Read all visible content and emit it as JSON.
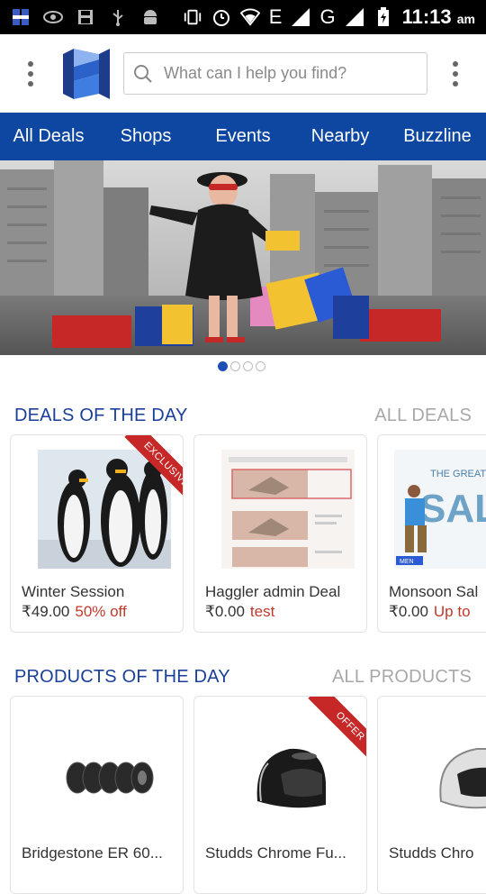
{
  "status_bar": {
    "network_label": "E",
    "network_label_2": "G",
    "time": "11:13",
    "ampm": "am"
  },
  "header": {
    "search_placeholder": "What can I help you find?"
  },
  "nav": {
    "tabs": [
      "All Deals",
      "Shops",
      "Events",
      "Nearby",
      "Buzzline"
    ]
  },
  "carousel": {
    "pages": 4,
    "active": 1
  },
  "deals": {
    "title": "DEALS OF THE DAY",
    "link": "ALL DEALS",
    "items": [
      {
        "name": "Winter Session",
        "price": "₹49.00",
        "tag": "50% off",
        "ribbon": "EXCLUSIVE"
      },
      {
        "name": "Haggler admin Deal",
        "price": "₹0.00",
        "tag": "test"
      },
      {
        "name": "Monsoon Sal",
        "price": "₹0.00",
        "tag": "Up to",
        "image_text": "SAL",
        "image_caption": "THE GREAT MO",
        "image_badge": "MEN"
      }
    ]
  },
  "products": {
    "title": "PRODUCTS OF THE DAY",
    "link": "ALL PRODUCTS",
    "items": [
      {
        "name": "Bridgestone ER 60..."
      },
      {
        "name": "Studds Chrome Fu...",
        "ribbon": "OFFER"
      },
      {
        "name": "Studds Chro"
      }
    ]
  },
  "colors": {
    "brand_blue": "#0d47a1",
    "accent_red": "#c62828",
    "price_tag": "#c0392b"
  }
}
